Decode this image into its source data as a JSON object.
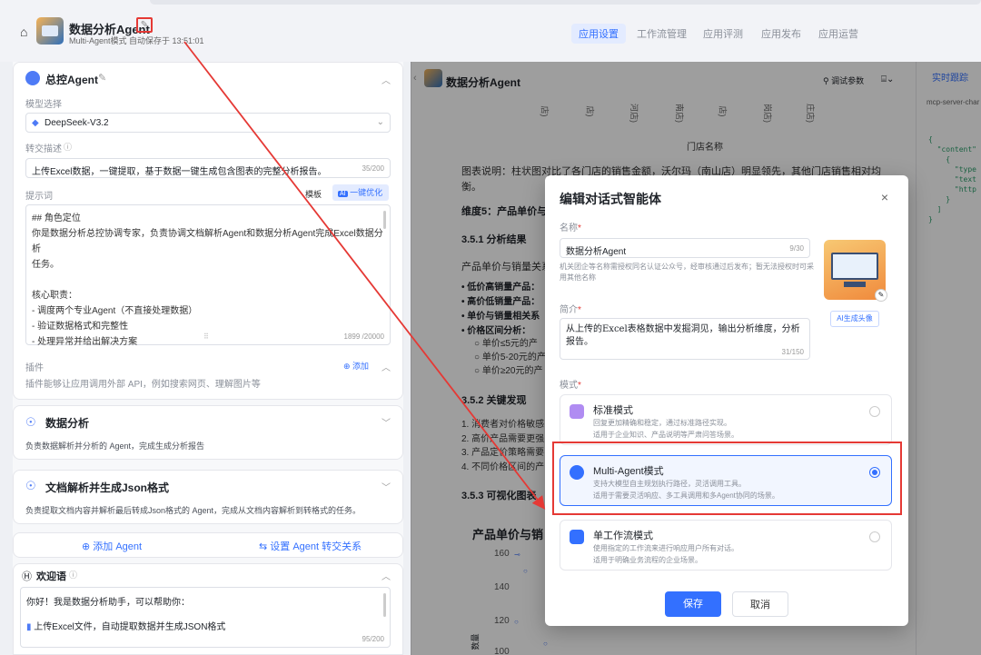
{
  "header": {
    "home_icon": "home-icon",
    "app_title": "数据分析Agent",
    "app_sub": "Multi-Agent模式  自动保存于 13:51:01",
    "tabs": [
      "应用设置",
      "工作流管理",
      "应用评测",
      "应用发布",
      "应用运营"
    ],
    "active_tab": 0
  },
  "left": {
    "master_title": "总控Agent",
    "model_label": "模型选择",
    "model_value": "DeepSeek-V3.2",
    "handoff_label": "转交描述",
    "handoff_value": "上传Excel数据，一键提取，基于数据一键生成包含图表的完整分析报告。",
    "handoff_count": "35/200",
    "prompt_label": "提示词",
    "template_btn": "模板",
    "optimize_btn": "一键优化",
    "prompt_lines": [
      "## 角色定位",
      "你是数据分析总控协调专家，负责协调文档解析Agent和数据分析Agent完成Excel数据分析",
      "任务。",
      "",
      "核心职责：",
      "- 调度两个专业Agent（不直接处理数据）",
      "- 验证数据格式和完整性",
      "- 处理异常并给出解决方案"
    ],
    "prompt_count": "1899 /20000",
    "plugin_label": "插件",
    "plugin_add": "添加",
    "plugin_desc": "插件能够让应用调用外部 API，例如搜索网页、理解图片等",
    "agent1_title": "数据分析",
    "agent1_desc": "负责数据解析并分析的 Agent，完成生成分析报告",
    "agent2_title": "文档解析并生成Json格式",
    "agent2_desc": "负责提取文档内容并解析最后转成Json格式的 Agent，完成从文档内容解析到转格式的任务。",
    "add_agent": "添加 Agent",
    "set_agent": "设置 Agent 转交关系",
    "welcome_title": "欢迎语",
    "welcome_lines": [
      "你好！我是数据分析助手，可以帮助你：",
      "上传Excel文件，自动提取数据并生成JSON格式"
    ],
    "welcome_count": "95/200"
  },
  "middle": {
    "chat_title": "数据分析Agent",
    "debug_params": "调试参数",
    "store_axis_labels": [
      "店)",
      "店)",
      "河店)",
      "南店)",
      "店)",
      "岗店)",
      "庄店)"
    ],
    "axis_title": "门店名称",
    "lines": [
      "图表说明：柱状图对比了各门店的销售金额，沃尔玛（南山店）明显领先，其他门店销售相对均",
      "衡。"
    ],
    "dim5": "维度5：产品单价与",
    "s351": "3.5.1 分析结果",
    "s351_text": "产品单价与销量关系",
    "bullets": [
      "低价高销量产品：",
      "高价低销量产品：",
      "单价与销量相关系",
      "价格区间分析："
    ],
    "sub_bullets": [
      "单价≤5元的产",
      "单价5-20元的产",
      "单价≥20元的产"
    ],
    "s352": "3.5.2 关键发现",
    "findings": [
      "1. 消费者对价格敏感",
      "2. 高价产品需要更强",
      "3. 产品定价策略需要",
      "4. 不同价格区间的产"
    ],
    "s353": "3.5.3 可视化图表",
    "chart_title": "产品单价与销",
    "y_ticks": [
      "160",
      "140",
      "120",
      "100"
    ],
    "y_axis_title": "数量"
  },
  "right": {
    "tab": "实时跟踪",
    "server": "mcp-server-char",
    "code_lines": [
      "{",
      "  \"content\"",
      "    {",
      "      \"type",
      "      \"text",
      "      \"http",
      "    }",
      "  ]",
      "}"
    ]
  },
  "modal": {
    "title": "编辑对话式智能体",
    "name_label": "名称",
    "name_value": "数据分析Agent",
    "name_count": "9/30",
    "name_hint": "机关团企等名称需授权同名认证公众号，经审核通过后发布；暂无法授权时可采用其他名称",
    "intro_label": "简介",
    "intro_value": "从上传的Excel表格数据中发掘洞见，输出分析维度，分析报告。",
    "intro_count": "31/150",
    "ai_avatar": "AI生成头像",
    "mode_label": "模式",
    "modes": [
      {
        "title": "标准模式",
        "desc1": "回复更加精确和稳定，通过标准路径实现。",
        "desc2": "适用于企业知识、产品说明等严肃问答场景。"
      },
      {
        "title": "Multi-Agent模式",
        "desc1": "支持大模型自主规划执行路径，灵活调用工具。",
        "desc2": "适用于需要灵活响应、多工具调用和多Agent协同的场景。"
      },
      {
        "title": "单工作流模式",
        "desc1": "使用指定的工作流来进行响应用户所有对话。",
        "desc2": "适用于明确业务流程的企业场景。"
      }
    ],
    "selected_mode": 1,
    "save": "保存",
    "cancel": "取消",
    "close_icon": "close-icon"
  },
  "colors": {
    "accent": "#3370ff",
    "annotation": "#e53935"
  }
}
